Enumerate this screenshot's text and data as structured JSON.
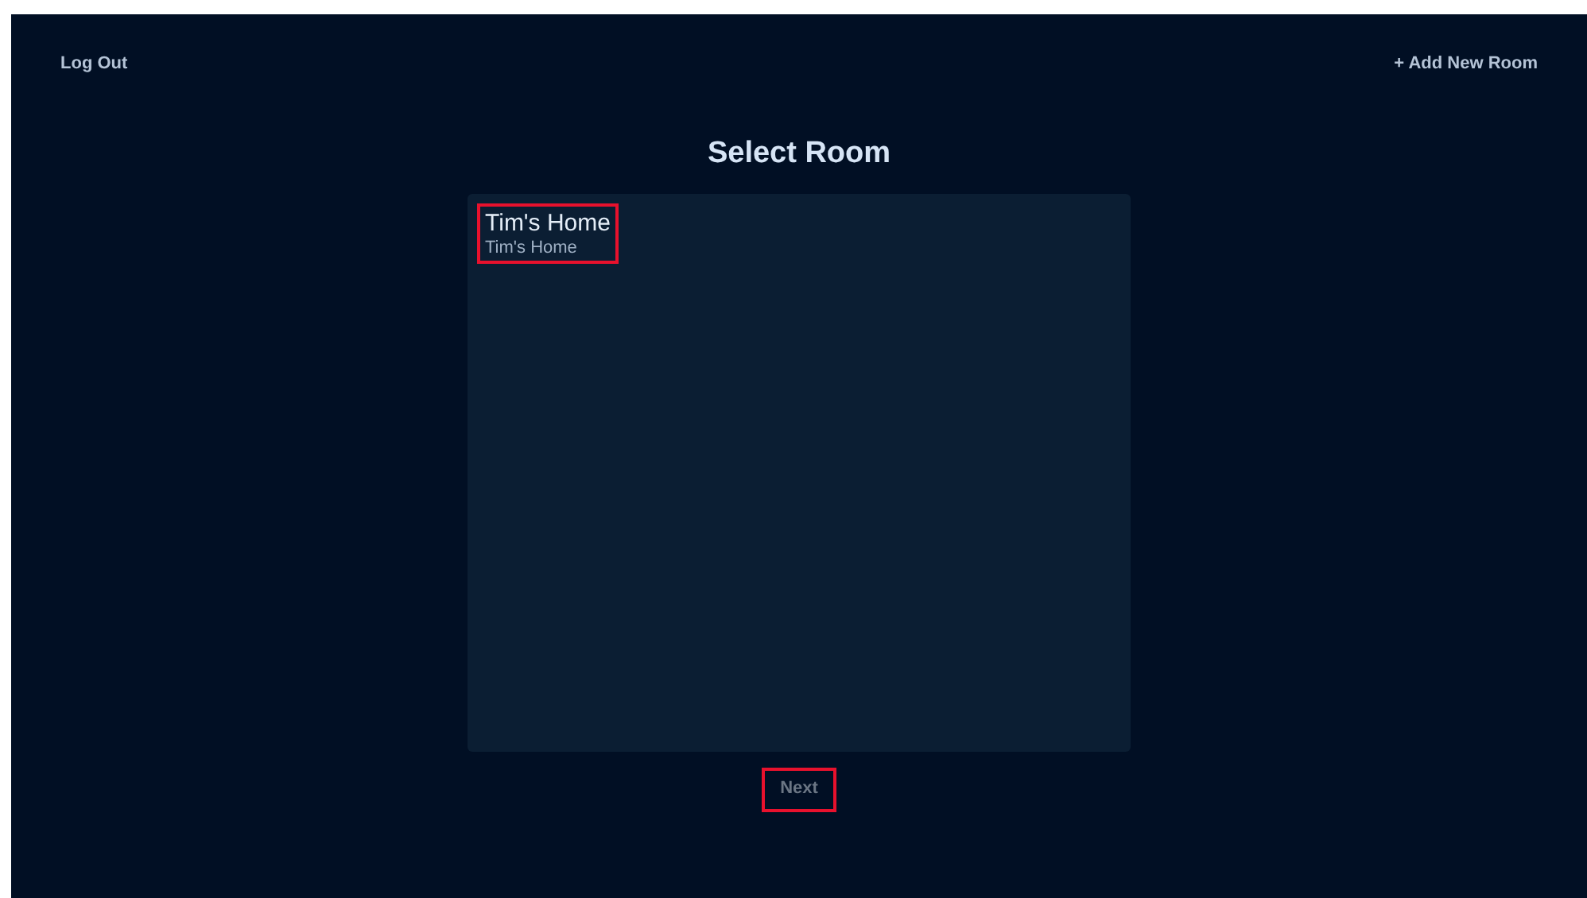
{
  "header": {
    "logout": "Log Out",
    "add_room": "+ Add New Room"
  },
  "title": "Select Room",
  "rooms": [
    {
      "name": "Tim's Home",
      "subtitle": "Tim's Home",
      "selected": true
    }
  ],
  "next": {
    "label": "Next",
    "disabled": true
  }
}
